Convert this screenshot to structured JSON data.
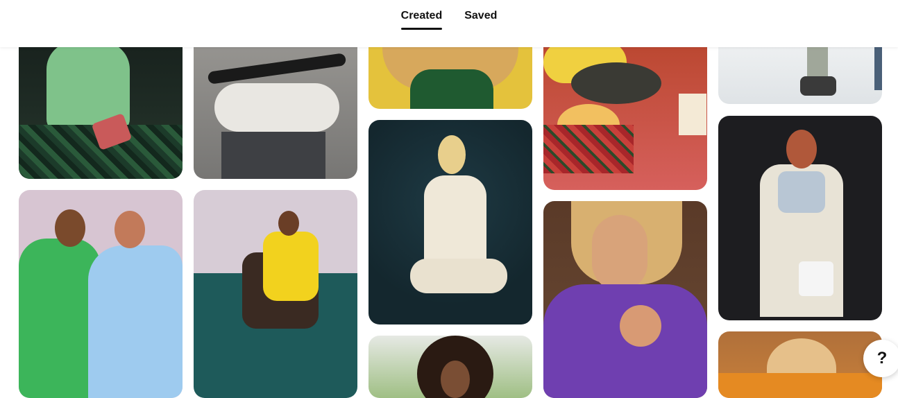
{
  "tabs": [
    {
      "label": "Created",
      "active": true
    },
    {
      "label": "Saved",
      "active": false
    }
  ],
  "help_button": {
    "label": "?",
    "icon": "question-mark-icon"
  },
  "pins": [
    {
      "id": "pin-green-suit-plaid",
      "colors": [
        "#2a3a2c",
        "#7fc28a"
      ]
    },
    {
      "id": "pin-bike-fur-seat",
      "colors": [
        "#8a8a88",
        "#e9e7e2"
      ]
    },
    {
      "id": "pin-green-sweater-hair",
      "colors": [
        "#e0b25a",
        "#1f5a30"
      ]
    },
    {
      "id": "pin-plaid-tablecloth-soup",
      "colors": [
        "#d6605c",
        "#f0c040"
      ]
    },
    {
      "id": "pin-snow-boots",
      "colors": [
        "#e9ecef",
        "#3a3a3a"
      ]
    },
    {
      "id": "pin-white-flared-jumpsuit",
      "colors": [
        "#14272e",
        "#efe8d8"
      ]
    },
    {
      "id": "pin-cream-coat-sweater",
      "colors": [
        "#1d1d20",
        "#e8e3d6"
      ]
    },
    {
      "id": "pin-green-blue-puffers",
      "colors": [
        "#d7c5d2",
        "#3cb55a"
      ]
    },
    {
      "id": "pin-yellow-dress-chair",
      "colors": [
        "#1e5a5a",
        "#f2d21e"
      ]
    },
    {
      "id": "pin-curly-hair-park",
      "colors": [
        "#9fbf84",
        "#2a1a12"
      ]
    },
    {
      "id": "pin-purple-velvet-blazer",
      "colors": [
        "#6f3fb0",
        "#d8a37a"
      ]
    },
    {
      "id": "pin-orange-fringe-blonde",
      "colors": [
        "#e58a22",
        "#f0d7b8"
      ]
    }
  ]
}
